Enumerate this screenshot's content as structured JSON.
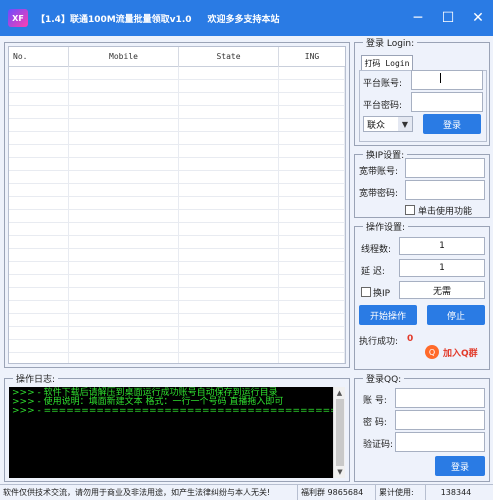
{
  "window": {
    "title": "【1.4】联通100M流量批量领取v1.0",
    "subtitle": "欢迎多多支持本站",
    "logo": "XF",
    "controls": [
      "minimize-icon",
      "maximize-icon",
      "close-icon"
    ]
  },
  "table": {
    "columns": [
      "No.",
      "Mobile",
      "State",
      "ING"
    ]
  },
  "log": {
    "legend": "操作日志:",
    "lines": [
      ">>> - 软件下载后请解压到桌面运行成功账号自动保存到运行目录",
      ">>> - 使用说明：填面新建文本 格式：一行一个号码 直播拖入即可",
      ">>> - ======================================================="
    ]
  },
  "login": {
    "legend": "登录 Login:",
    "tab": "打码 Login",
    "account_label": "平台账号:",
    "password_label": "平台密码:",
    "provider_select": "联众",
    "login_button": "登录"
  },
  "ip": {
    "legend": "换IP设置:",
    "account_label": "宽带账号:",
    "password_label": "宽带密码:",
    "checkbox_label": "单击使用功能"
  },
  "ops": {
    "legend": "操作设置:",
    "threads_label": "线程数:",
    "threads_value": "1",
    "delay_label": "延 迟:",
    "delay_value": "1",
    "changeip_label": "换IP",
    "changeip_value": "无需",
    "start_button": "开始操作",
    "stop_button": "停止",
    "success_label": "执行成功:",
    "success_count": "0",
    "qq_group": "加入Q群"
  },
  "qqlogin": {
    "legend": "登录QQ:",
    "account_label": "账 号:",
    "password_label": "密 码:",
    "captcha_label": "验证码:",
    "login_button": "登录"
  },
  "status": {
    "notice": "软件仅供技术交流，请勿用于商业及非法用途，如产生法律纠纷与本人无关!",
    "group_label": "福利群",
    "group_number": "9865684",
    "usage_label": "累计使用:",
    "usage_count": "138344"
  },
  "colors": {
    "accent": "#2a7be4",
    "log_bg": "#000000",
    "log_text": "#2fe12f",
    "highlight_red": "#e23a2a"
  }
}
